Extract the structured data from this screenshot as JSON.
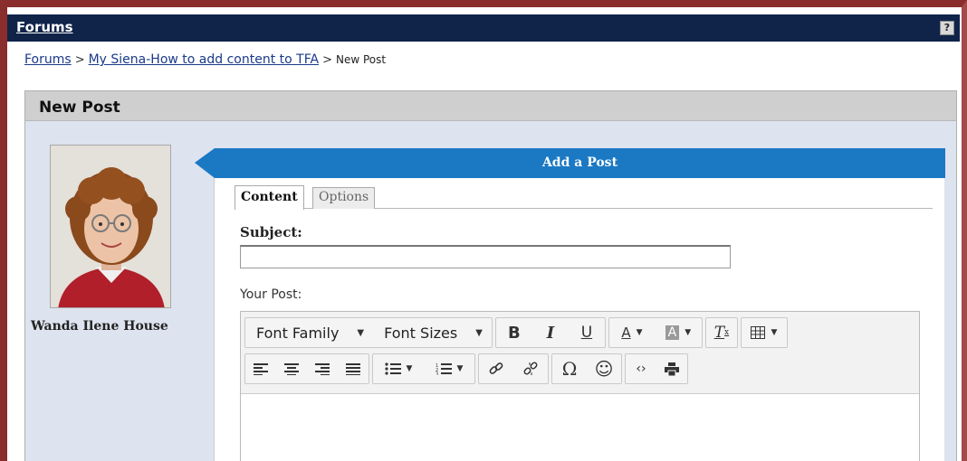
{
  "header": {
    "title": "Forums",
    "help_icon": "?"
  },
  "breadcrumb": {
    "item1": "Forums",
    "sep": ">",
    "item2": "My Siena-How to add content to TFA",
    "current": "New Post"
  },
  "panel": {
    "title": "New Post"
  },
  "author": {
    "name": "Wanda Ilene House"
  },
  "compose": {
    "banner": "Add a Post",
    "tabs": {
      "content": "Content",
      "options": "Options"
    },
    "subject_label": "Subject:",
    "subject_value": "",
    "post_label": "Your Post:"
  },
  "toolbar": {
    "font_family": "Font Family",
    "font_sizes": "Font Sizes",
    "bold": "B",
    "italic": "I",
    "underline": "U",
    "text_color": "A",
    "bg_color": "A",
    "clear_format": "T",
    "omega": "Ω",
    "emoji": "☺",
    "code": "‹›"
  },
  "colors": {
    "titlebar": "#10244a",
    "banner": "#1b79c4",
    "frame": "#8a2d2d",
    "panel_bg": "#dde3ef"
  }
}
